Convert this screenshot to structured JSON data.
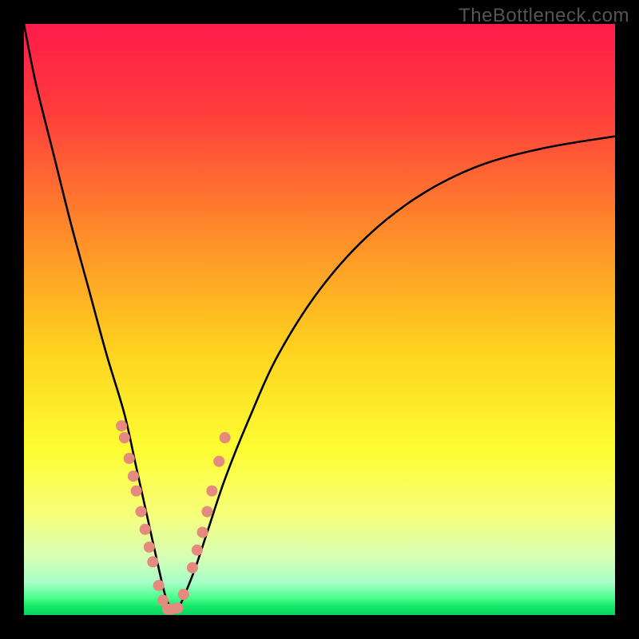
{
  "watermark": "TheBottleneck.com",
  "chart_data": {
    "type": "line",
    "title": "",
    "xlabel": "",
    "ylabel": "",
    "xlim": [
      0,
      100
    ],
    "ylim": [
      0,
      100
    ],
    "grid": false,
    "legend": false,
    "gradient_stops": [
      {
        "offset": 0.0,
        "color": "#ff1b4a"
      },
      {
        "offset": 0.15,
        "color": "#ff3d3c"
      },
      {
        "offset": 0.35,
        "color": "#ff8a2a"
      },
      {
        "offset": 0.55,
        "color": "#ffd21f"
      },
      {
        "offset": 0.72,
        "color": "#fdfd32"
      },
      {
        "offset": 0.83,
        "color": "#f6ff7a"
      },
      {
        "offset": 0.9,
        "color": "#d8ffb4"
      },
      {
        "offset": 0.945,
        "color": "#a8ffc8"
      },
      {
        "offset": 0.97,
        "color": "#4dff8c"
      },
      {
        "offset": 0.985,
        "color": "#16e86a"
      },
      {
        "offset": 1.0,
        "color": "#0ad35e"
      }
    ],
    "series": [
      {
        "name": "bottleneck-curve",
        "note": "V-shaped bottleneck curve; y = mismatch magnitude (100 = worst, 0 = optimal). Minimum (optimal point) near x ≈ 25.",
        "x": [
          0,
          2,
          5,
          8,
          11,
          14,
          17,
          19,
          21,
          23,
          24,
          25,
          26,
          27,
          29,
          31,
          34,
          38,
          43,
          50,
          58,
          67,
          77,
          88,
          100
        ],
        "y": [
          100,
          90,
          78,
          66,
          55,
          44,
          34,
          25,
          16,
          7,
          3,
          1,
          1,
          3,
          8,
          14,
          23,
          33,
          44,
          55,
          64,
          71,
          76,
          79,
          81
        ]
      }
    ],
    "scatter": {
      "name": "sample-points",
      "note": "Salmon dots clustered along both flanks of the V in the lower third of the chart.",
      "color": "#e58a7e",
      "x": [
        16.5,
        17.0,
        17.8,
        18.5,
        19.0,
        19.8,
        20.5,
        21.2,
        21.8,
        22.8,
        23.5,
        24.3,
        25.0,
        26.0,
        27.0,
        28.5,
        29.3,
        30.2,
        31.0,
        31.8,
        33.0,
        34.0
      ],
      "y": [
        32.0,
        30.0,
        26.5,
        23.5,
        21.0,
        17.5,
        14.5,
        11.5,
        9.0,
        5.0,
        2.5,
        1.0,
        1.0,
        1.2,
        3.5,
        8.0,
        11.0,
        14.0,
        17.5,
        21.0,
        26.0,
        30.0
      ]
    }
  }
}
